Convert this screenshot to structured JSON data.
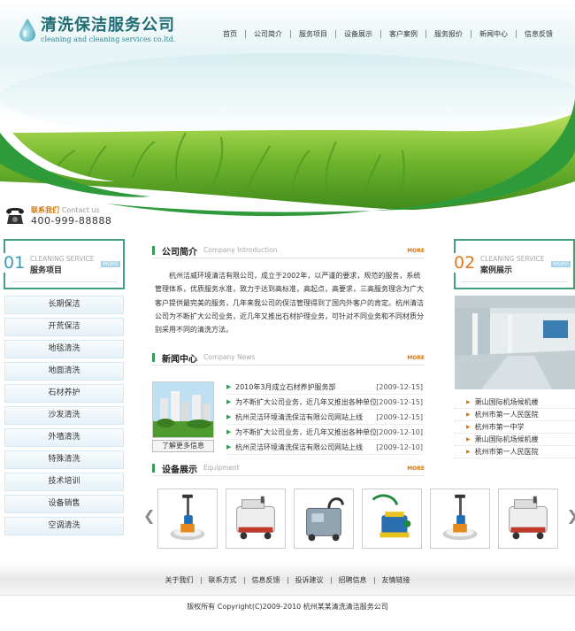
{
  "brand": {
    "title": "清洗保洁服务公司",
    "subtitle": "cleaning and cleaning services co.ltd."
  },
  "nav": [
    "首页",
    "公司简介",
    "服务项目",
    "设备展示",
    "客户案例",
    "服务报价",
    "新闻中心",
    "信息反馈"
  ],
  "contact": {
    "label": "联系我们",
    "label_en": "Contact us",
    "phone": "400-999-88888"
  },
  "services_box": {
    "num": "01",
    "en": "CLEANING SERVICE",
    "cn": "服务项目",
    "more": "MORE",
    "items": [
      "长期保洁",
      "开荒保洁",
      "地毯清洗",
      "地面清洗",
      "石材养护",
      "沙发清洗",
      "外墙清洗",
      "特殊清洗",
      "技术培训",
      "设备销售",
      "空调清洗"
    ]
  },
  "about": {
    "title": "公司简介",
    "title_en": "Company Introduction",
    "more": "MORE",
    "text": "杭州洁威环境清洁有限公司，成立于2002年，以严谨的要求，规范的服务，系统管理体系，优质服务水准，致力于达到高标准，高起点，高要求，三高服务理念为广大客户提供最完美的服务，几年来我公司的保洁管理得到了国内外客户的肯定。杭州清洁公司为不断扩大公司业务，近几年又推出石材护理业务，可针对不同业务和不同材质分别采用不同的清洗方法。"
  },
  "news": {
    "title": "新闻中心",
    "title_en": "Company News",
    "more": "MORE",
    "more_button": "了解更多信息",
    "items": [
      {
        "title": "2010年3月成立石材养护服务部",
        "date": "[2009-12-15]"
      },
      {
        "title": "为不断扩大公司业务，近几年又推出各种单位",
        "date": "[2009-12-15]"
      },
      {
        "title": "杭州灵洁环境清洗保洁有限公司网站上线",
        "date": "[2009-12-15]"
      },
      {
        "title": "为不断扩大公司业务，近几年又推出各种单位",
        "date": "[2009-12-10]"
      },
      {
        "title": "杭州灵洁环境清洗保洁有限公司网站上线",
        "date": "[2009-12-10]"
      }
    ]
  },
  "equipment": {
    "title": "设备展示",
    "title_en": "Equipment",
    "more": "MORE",
    "items": [
      "floor-polisher",
      "scrubber-dryer",
      "carpet-extractor",
      "pool-cleaner",
      "floor-polisher",
      "scrubber-dryer"
    ]
  },
  "cases_box": {
    "num": "02",
    "en": "CLEANING SERVICE",
    "cn": "案例展示",
    "more": "MORE",
    "items": [
      "萧山国际机场候机楼",
      "杭州市第一人民医院",
      "杭州市第一中学",
      "萧山国际机场候机楼",
      "杭州市第一人民医院"
    ]
  },
  "footer": {
    "links": [
      "关于我们",
      "联系方式",
      "信息反馈",
      "投诉建议",
      "招聘信息",
      "友情链接"
    ],
    "copyright": "版权所有  Copyright(C)2009-2010 杭州某某清洗清洁服务公司"
  },
  "colors": {
    "accent_green": "#3a9b5a",
    "accent_orange": "#d27a12",
    "brand_teal": "#1f6c73"
  }
}
